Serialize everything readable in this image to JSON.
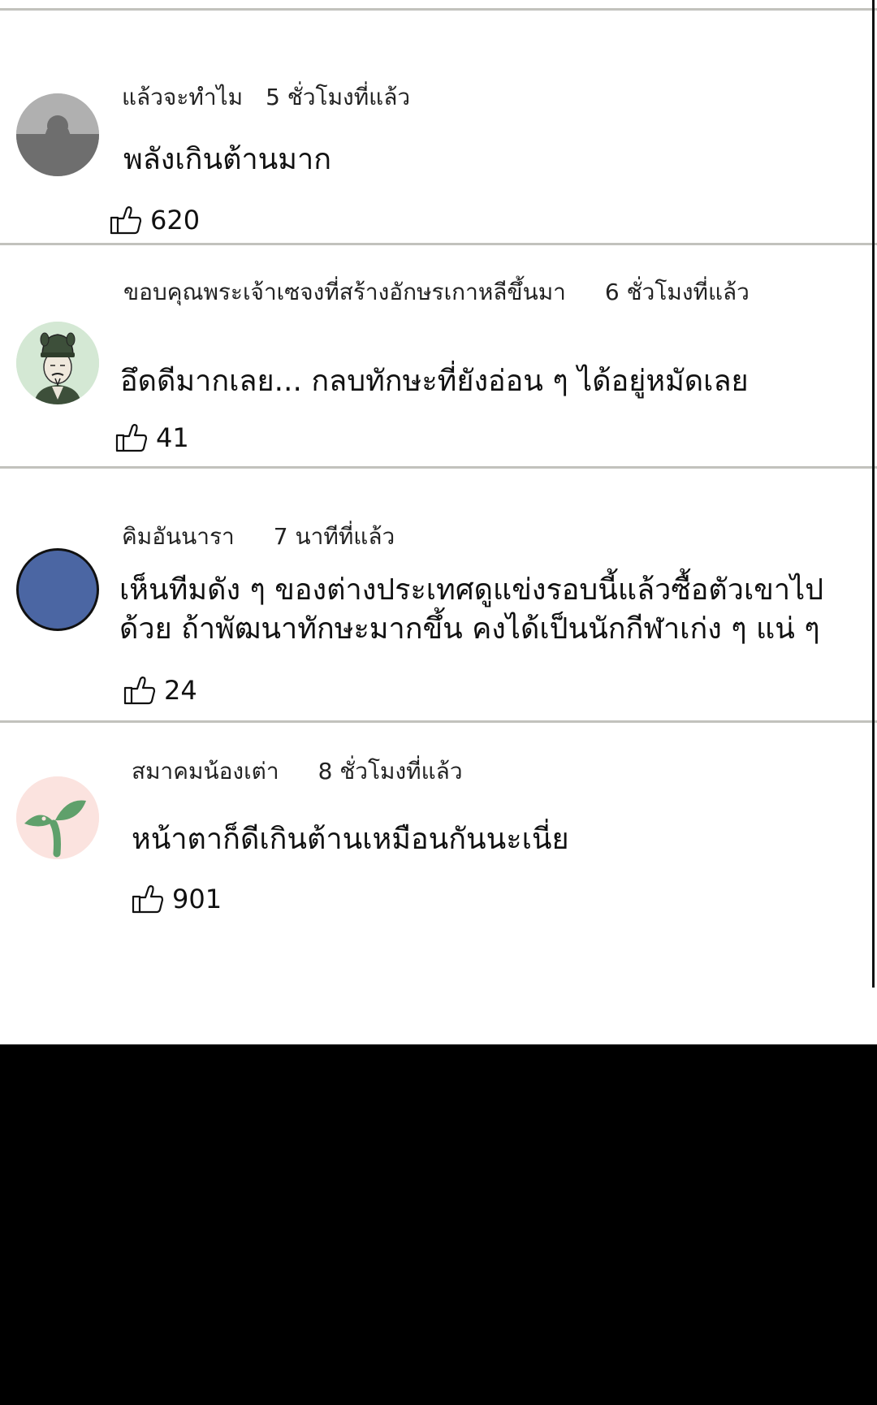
{
  "comments": [
    {
      "author": "แล้วจะทำไม",
      "time": "5 ชั่วโมงที่แล้ว",
      "lines": [
        "พลังเกินต้านมาก"
      ],
      "likes": "620",
      "avatar": "default-person-avatar"
    },
    {
      "author": "ขอบคุณพระเจ้าเซจงที่สร้างอักษรเกาหลีขึ้นมา",
      "time": "6 ชั่วโมงที่แล้ว",
      "lines": [
        "อึดดีมากเลย... กลบทักษะที่ยังอ่อน ๆ ได้อยู่หมัดเลย"
      ],
      "likes": "41",
      "avatar": "king-sejong-avatar"
    },
    {
      "author": "คิมอันนารา",
      "time": "7 นาทีที่แล้ว",
      "lines": [
        "เห็นทีมดัง ๆ ของต่างประเทศดูแข่งรอบนี้แล้วซื้อตัวเขาไป",
        "ด้วย ถ้าพัฒนาทักษะมากขึ้น คงได้เป็นนักกีฬาเก่ง ๆ แน่ ๆ"
      ],
      "likes": "24",
      "avatar": "blue-circle-avatar"
    },
    {
      "author": "สมาคมน้องเต่า",
      "time": "8 ชั่วโมงที่แล้ว",
      "lines": [
        "หน้าตาก็ดีเกินต้านเหมือนกันนะเนี่ย"
      ],
      "likes": "901",
      "avatar": "sprout-avatar"
    }
  ],
  "icons": {
    "like": "thumbs-up-icon"
  },
  "colors": {
    "divider": "#c2c2bd",
    "blue_avatar": "#4b66a3",
    "sprout_bg": "#fbe3df",
    "sprout_leaf": "#5fa06b",
    "sejong_bg": "#d4e8d4"
  }
}
